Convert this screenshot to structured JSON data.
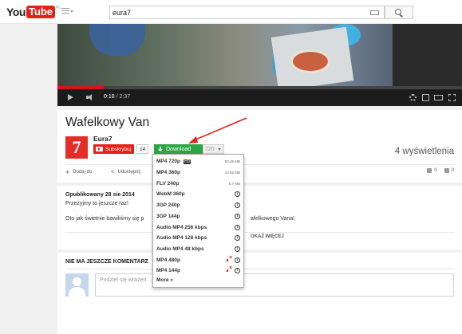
{
  "masthead": {
    "logo_you": "You",
    "logo_tube": "Tube",
    "logo_region": "PL",
    "search_value": "eura7"
  },
  "player": {
    "current_time": "0:18",
    "duration": "2:37",
    "progress": 0.115
  },
  "video": {
    "title": "Wafelkowy Van",
    "channel_name": "Eura7",
    "channel_initial": "7",
    "subscribe_label": "Subskrybuj",
    "subscriber_count": "14",
    "download_label": "Download",
    "quality_selected": "720",
    "views": "4 wyświetlenia",
    "add_to_label": "Dodaj do",
    "share_label": "Udostępnij",
    "likes": "0",
    "dislikes": "0"
  },
  "description": {
    "published": "Opublikowany 28 sie 2014",
    "line1": "Przeżyjmy to jeszcze raz!",
    "line2_start": "Oto jak świetnie bawiliśmy się p",
    "line2_end": "afelkowego Vana!",
    "show_more": "OKAŻ WIĘCEJ"
  },
  "comments": {
    "heading": "NIE MA JESZCZE KOMENTARZ",
    "placeholder": "Podziel się wrażen"
  },
  "download_menu": {
    "items": [
      {
        "label": "MP4 720p",
        "hd": "HD",
        "size": "53.45 MB",
        "icon": "size"
      },
      {
        "label": "MP4 360p",
        "size": "13.55 MB",
        "icon": "size"
      },
      {
        "label": "FLV 240p",
        "size": "6.7 MB",
        "icon": "size"
      },
      {
        "label": "WebM 360p",
        "icon": "info-icon"
      },
      {
        "label": "3GP 240p",
        "icon": "info-icon"
      },
      {
        "label": "3GP 144p",
        "icon": "info-icon"
      },
      {
        "label": "Audio MP4 256 kbps",
        "icon": "info-icon"
      },
      {
        "label": "Audio MP4 128 kbps",
        "icon": "info-icon"
      },
      {
        "label": "Audio MP4 48 kbps",
        "icon": "info-icon"
      },
      {
        "label": "MP4 480p",
        "icon": "info-icon",
        "muted": true
      },
      {
        "label": "MP4 144p",
        "icon": "info-icon",
        "muted": true
      }
    ],
    "more_label": "More «"
  },
  "colors": {
    "youtube_red": "#e62117",
    "download_green": "#2aa744",
    "annotation_arrow": "#e0261c"
  }
}
